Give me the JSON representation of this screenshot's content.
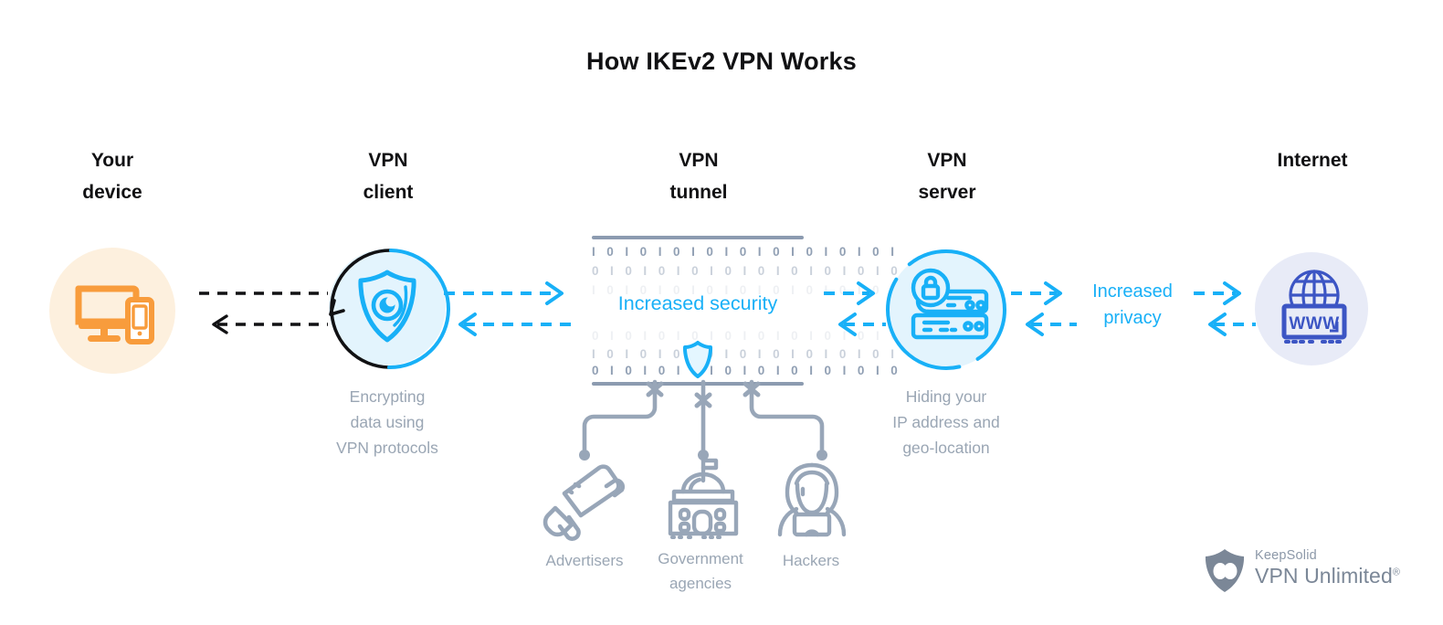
{
  "title": "How IKEv2 VPN Works",
  "columns": [
    {
      "key": "device",
      "label": "Your\ndevice"
    },
    {
      "key": "client",
      "label": "VPN\nclient"
    },
    {
      "key": "tunnel",
      "label": "VPN\ntunnel"
    },
    {
      "key": "server",
      "label": "VPN\nserver"
    },
    {
      "key": "internet",
      "label": "Internet"
    }
  ],
  "nodes": {
    "device": {
      "icon": "monitor-and-phone-icon",
      "caption": ""
    },
    "client": {
      "icon": "shield-eye-icon",
      "caption": "Encrypting\ndata using\nVPN protocols"
    },
    "server": {
      "icon": "server-lock-icon",
      "caption": "Hiding your\nIP address and\ngeo-location"
    },
    "internet": {
      "icon": "globe-www-icon",
      "caption": ""
    }
  },
  "tunnel": {
    "label": "Increased security",
    "binary_rows": [
      "I 0 I 0 I 0  I 0 I 0 I 0 I 0 I 0  I 0 I",
      "0 I 0 I 0 I 0  I 0 I 0 I 0 I 0 I 0  I 0",
      "I 0 I 0 I 0  I 0 I 0 I 0 I 0 I 0  I 0 I",
      "0 I 0 I 0 I 0  I 0 I 0 I 0 I 0 I 0  I 0",
      "I 0 I 0 I 0  I 0 I 0 I 0 I 0 I 0  I 0 I",
      "0 I 0 I 0 I 0  I 0 I 0 I 0 I 0 I 0  I 0"
    ],
    "shield_icon": "shield-icon"
  },
  "threats": [
    {
      "label": "Advertisers",
      "icon": "megaphone-icon"
    },
    {
      "label": "Government\nagencies",
      "icon": "government-building-icon"
    },
    {
      "label": "Hackers",
      "icon": "hooded-hacker-icon"
    }
  ],
  "mid_labels": {
    "privacy": "Increased\nprivacy"
  },
  "logo": {
    "brand_top": "KeepSolid",
    "brand_main": "VPN Unlimited",
    "registered": "®",
    "icon": "keepsolid-shield-icon"
  },
  "colors": {
    "accent_blue": "#18b0f7",
    "device_orange": "#f89c3c",
    "device_bg": "#fdf0de",
    "node_bg_blue": "#e3f4fd",
    "internet_indigo": "#3c55c4",
    "internet_bg": "#e8ebf7",
    "gray_text": "#9aa6b4",
    "gray_line": "#8c9bb0",
    "title_black": "#111113"
  }
}
